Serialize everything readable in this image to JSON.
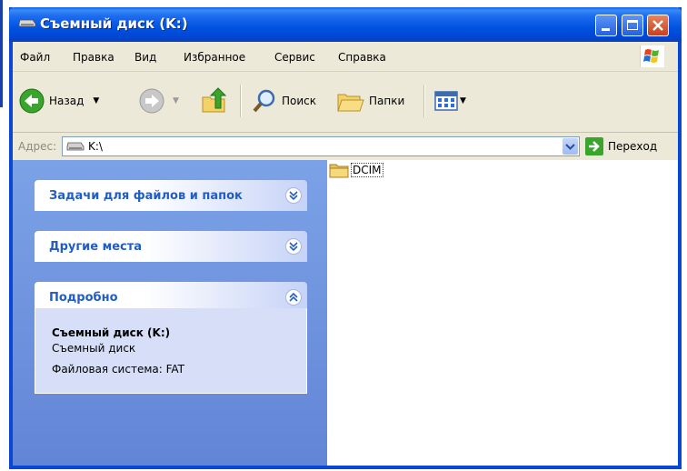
{
  "window": {
    "title": "Съемный диск (K:)"
  },
  "menu": {
    "items": [
      "Файл",
      "Правка",
      "Вид",
      "Избранное",
      "Сервис",
      "Справка"
    ]
  },
  "toolbar": {
    "back_label": "Назад",
    "search_label": "Поиск",
    "folders_label": "Папки"
  },
  "address": {
    "label": "Адрес:",
    "value": "K:\\",
    "go_label": "Переход"
  },
  "left_pane": {
    "tasks_title": "Задачи для файлов и папок",
    "other_places_title": "Другие места",
    "details_title": "Подробно",
    "details": {
      "name": "Съемный диск (K:)",
      "type": "Съемный диск",
      "filesystem": "Файловая система: FAT"
    }
  },
  "files": [
    {
      "name": "DCIM",
      "icon": "folder-icon"
    }
  ],
  "colors": {
    "title_bar": "#0052e0",
    "task_pane": "#6f94de",
    "panel_title": "#215dc6"
  }
}
